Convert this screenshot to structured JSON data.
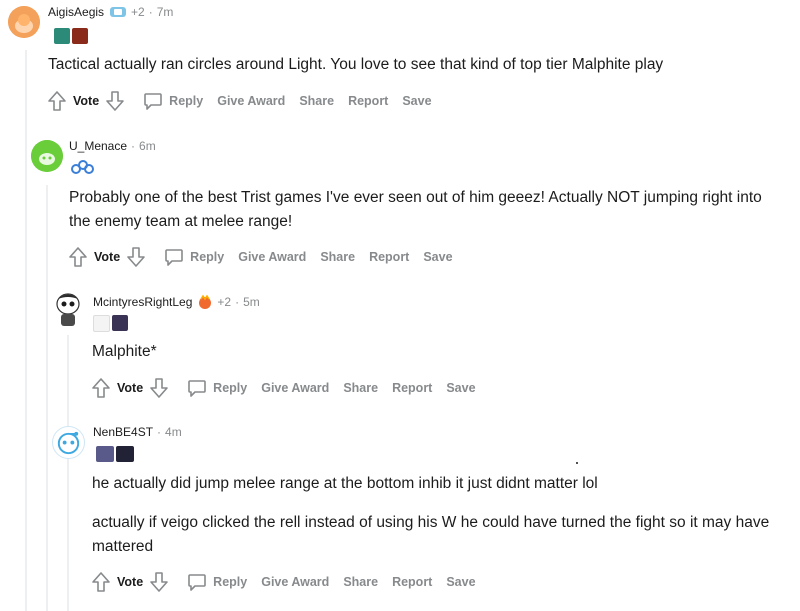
{
  "comments": [
    {
      "username": "AigisAegis",
      "bonus": "+2",
      "time": "7m",
      "avatar_color": "#f4a25b",
      "paragraphs": [
        "Tactical actually ran circles around Light. You love to see that kind of top tier Malphite play"
      ],
      "actions": {
        "vote": "Vote",
        "reply": "Reply",
        "award": "Give Award",
        "share": "Share",
        "report": "Report",
        "save": "Save"
      }
    },
    {
      "username": "U_Menace",
      "time": "6m",
      "avatar_color": "#6acd3a",
      "paragraphs": [
        "Probably one of the best Trist games I've ever seen out of him geeez! Actually NOT jumping right into the enemy team at melee range!"
      ],
      "actions": {
        "vote": "Vote",
        "reply": "Reply",
        "award": "Give Award",
        "share": "Share",
        "report": "Report",
        "save": "Save"
      }
    },
    {
      "username": "McintyresRightLeg",
      "bonus": "+2",
      "time": "5m",
      "avatar_color": "#e8e8e8",
      "paragraphs": [
        "Malphite*"
      ],
      "actions": {
        "vote": "Vote",
        "reply": "Reply",
        "award": "Give Award",
        "share": "Share",
        "report": "Report",
        "save": "Save"
      }
    },
    {
      "username": "NenBE4ST",
      "time": "4m",
      "avatar_color": "#3ea8e0",
      "paragraphs": [
        "he actually did jump melee range at the bottom inhib it just didnt matter lol",
        "actually if veigo clicked the rell instead of using his W he could have turned the fight so it may have mattered"
      ],
      "actions": {
        "vote": "Vote",
        "reply": "Reply",
        "award": "Give Award",
        "share": "Share",
        "report": "Report",
        "save": "Save"
      }
    }
  ],
  "colors": {
    "meta_gray": "#878a8c",
    "thread_line": "#edeff1"
  }
}
